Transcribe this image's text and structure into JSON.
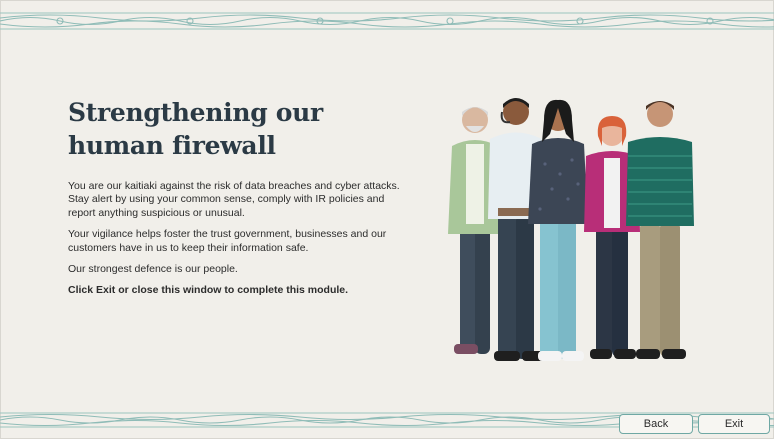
{
  "slide": {
    "title_line1": "Strengthening our",
    "title_line2": "human firewall",
    "paragraph1": "You are our kaitiaki against the risk of data breaches and cyber attacks. Stay alert by using your common sense, comply with IR policies and report anything suspicious or unusual.",
    "paragraph2": "Your vigilance helps foster the trust government, businesses and our customers have in us to keep their information safe.",
    "paragraph3": "Our strongest defence is our people.",
    "instruction": "Click Exit or close this window to complete this module."
  },
  "nav": {
    "back_label": "Back",
    "exit_label": "Exit"
  },
  "colors": {
    "background": "#f1efea",
    "pattern": "#7fb3ae",
    "title": "#2b3a45",
    "button_border": "#6fa8a4"
  },
  "illustration": {
    "icon": "group-of-people-illustration"
  }
}
